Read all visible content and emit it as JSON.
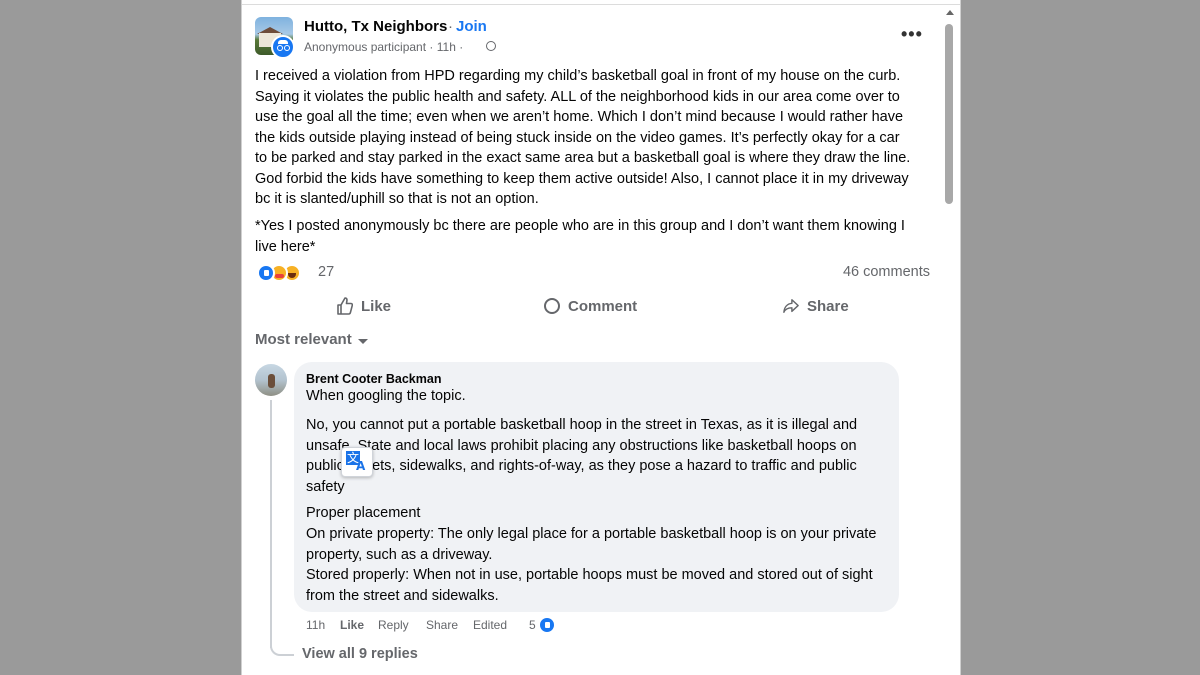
{
  "post": {
    "group_name": "Hutto, Tx Neighbors",
    "separator": "·",
    "join_label": "Join",
    "author": "Anonymous participant",
    "time": "11h",
    "meta_text": "Anonymous participant · 11h ·",
    "more_icon": "more-horizontal-icon",
    "body_paragraph_1": "I received a violation from HPD regarding my child’s basketball goal in front of my house on the curb. Saying it violates the public health and safety. ALL of the neighborhood kids in our area come over to use the goal all the time; even when we aren’t home. Which I don’t mind because I would rather have the kids outside playing instead of being stuck inside on the video games. It’s perfectly okay for a car to be parked and stay parked in the exact same area but a basketball goal is where they draw the line. God forbid the kids have something to keep them active outside! Also, I cannot place it in my driveway bc it is slanted/uphill so that is not an option.",
    "body_paragraph_2": "*Yes I posted anonymously bc there are people who are in this group and I don’t want them knowing I live here*",
    "reaction_count": "27",
    "comment_count": "46 comments"
  },
  "actions": {
    "like": "Like",
    "comment": "Comment",
    "share": "Share"
  },
  "sort": {
    "label": "Most relevant"
  },
  "comment": {
    "author": "Brent Cooter Backman",
    "line_1": "When googling the topic.",
    "paragraph_1": "No, you cannot put a portable basketball hoop in the street in Texas, as it is illegal and unsafe. State and local laws prohibit placing any obstructions like basketball hoops on public streets, sidewalks, and rights-of-way, as they pose a hazard to traffic and public safety",
    "line_2": "Proper placement",
    "paragraph_2": "On private property: The only legal place for a portable basketball hoop is on your private property, such as a driveway.",
    "paragraph_3": "Stored properly: When not in use, portable hoops must be moved and stored out of sight from the street and sidewalks.",
    "time": "11h",
    "like": "Like",
    "reply": "Reply",
    "share": "Share",
    "edited": "Edited",
    "like_count": "5",
    "view_replies": "View all 9 replies"
  },
  "colors": {
    "accent": "#1877f2",
    "secondary_text": "#65676b",
    "bubble": "#f0f2f5"
  }
}
